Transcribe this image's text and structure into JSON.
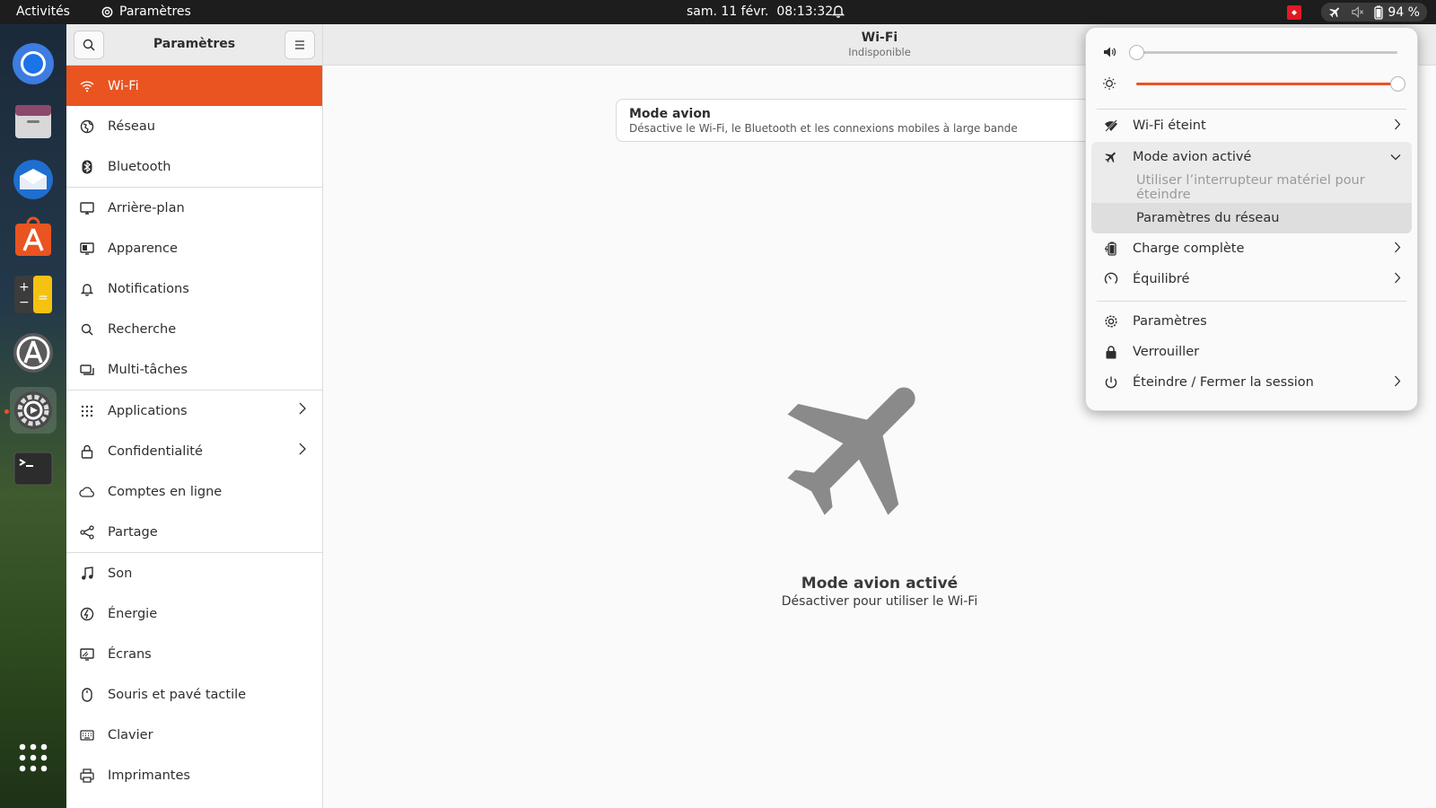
{
  "topbar": {
    "activities": "Activités",
    "app_name": "Paramètres",
    "clock": "sam. 11 févr.  08:13:32",
    "battery_percent": "94 %"
  },
  "dock": {
    "items": [
      "chromium-icon",
      "files-icon",
      "thunderbird-icon",
      "app-center-icon",
      "calculator-icon",
      "software-updater-icon",
      "settings-icon",
      "terminal-icon"
    ],
    "active": "settings-icon",
    "show_apps": "grid-icon"
  },
  "sidebar": {
    "title": "Paramètres",
    "items": [
      {
        "label": "Wi-Fi",
        "icon": "wifi-icon",
        "selected": true
      },
      {
        "label": "Réseau",
        "icon": "network-icon"
      },
      {
        "label": "Bluetooth",
        "icon": "bluetooth-icon"
      },
      {
        "label": "Arrière-plan",
        "icon": "background-icon"
      },
      {
        "label": "Apparence",
        "icon": "appearance-icon"
      },
      {
        "label": "Notifications",
        "icon": "bell-icon"
      },
      {
        "label": "Recherche",
        "icon": "search-icon"
      },
      {
        "label": "Multi-tâches",
        "icon": "multitasking-icon"
      },
      {
        "label": "Applications",
        "icon": "apps-grid-icon",
        "chevron": true
      },
      {
        "label": "Confidentialité",
        "icon": "lock-icon",
        "chevron": true
      },
      {
        "label": "Comptes en ligne",
        "icon": "cloud-icon"
      },
      {
        "label": "Partage",
        "icon": "share-icon"
      },
      {
        "label": "Son",
        "icon": "music-note-icon"
      },
      {
        "label": "Énergie",
        "icon": "power-icon"
      },
      {
        "label": "Écrans",
        "icon": "display-icon"
      },
      {
        "label": "Souris et pavé tactile",
        "icon": "mouse-icon"
      },
      {
        "label": "Clavier",
        "icon": "keyboard-icon"
      },
      {
        "label": "Imprimantes",
        "icon": "printer-icon"
      }
    ]
  },
  "main": {
    "title": "Wi-Fi",
    "subtitle": "Indisponible",
    "airplane_row": {
      "title": "Mode avion",
      "description": "Désactive le Wi-Fi, le Bluetooth et les connexions mobiles à large bande"
    },
    "empty_title": "Mode avion activé",
    "empty_subtitle": "Désactiver pour utiliser le Wi-Fi"
  },
  "quick_settings": {
    "volume_level": 0.0,
    "brightness_level": 1.0,
    "items": {
      "wifi": "Wi-Fi éteint",
      "airplane": "Mode avion activé",
      "airplane_sub_disabled": "Utiliser l’interrupteur matériel pour éteindre",
      "airplane_sub_settings": "Paramètres du réseau",
      "battery": "Charge complète",
      "power_mode": "Équilibré",
      "settings": "Paramètres",
      "lock": "Verrouiller",
      "power_off": "Éteindre / Fermer la session"
    }
  },
  "colors": {
    "accent": "#e95420",
    "topbar": "#1d1d1d"
  }
}
